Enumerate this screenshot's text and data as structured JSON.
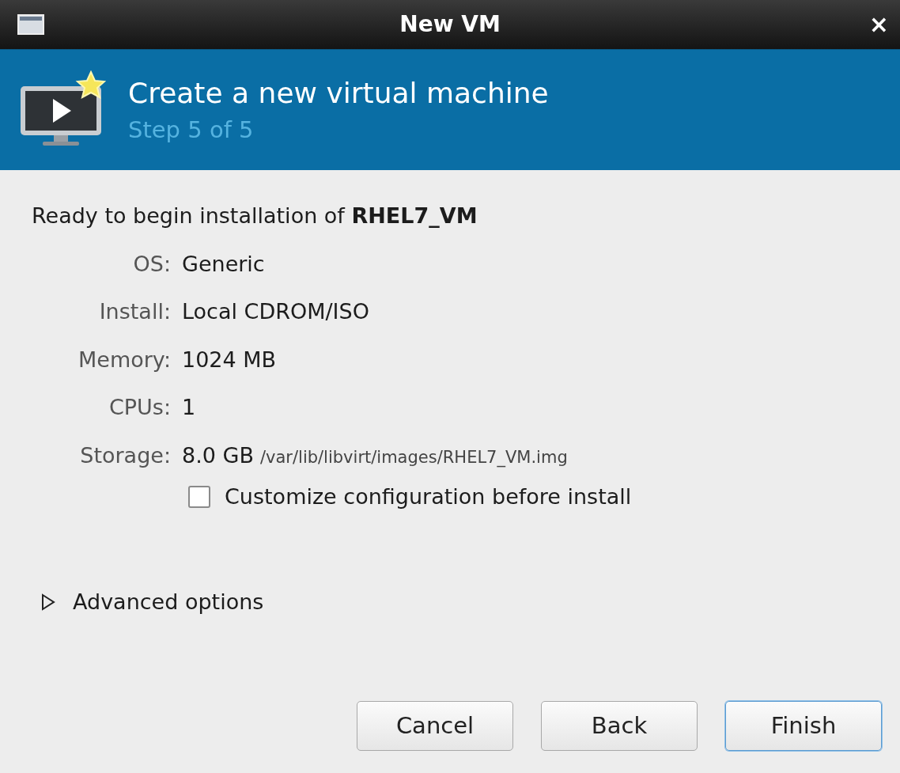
{
  "window": {
    "title": "New VM",
    "close": "×"
  },
  "header": {
    "title": "Create a new virtual machine",
    "subtitle": "Step 5 of 5"
  },
  "summary": {
    "intro": "Ready to begin installation of **RHEL7_VM**",
    "rows": [
      {
        "label": "OS:",
        "value": "Generic"
      },
      {
        "label": "Install:",
        "value": "Local CDROM/ISO"
      },
      {
        "label": "Memory:",
        "value": "1024 MB"
      },
      {
        "label": "CPUs:",
        "value": "1"
      },
      {
        "label": "Storage:",
        "value": "8.0 GB",
        "detail": "/var/lib/libvirt/images/RHEL7_VM.img"
      }
    ]
  },
  "customize": {
    "label": "Customize configuration before install",
    "checked": false
  },
  "advanced": {
    "label": "Advanced options",
    "expanded": false
  },
  "buttons": [
    {
      "label": "Cancel",
      "default": false
    },
    {
      "label": "Back",
      "default": false
    },
    {
      "label": "Finish",
      "default": true
    }
  ]
}
